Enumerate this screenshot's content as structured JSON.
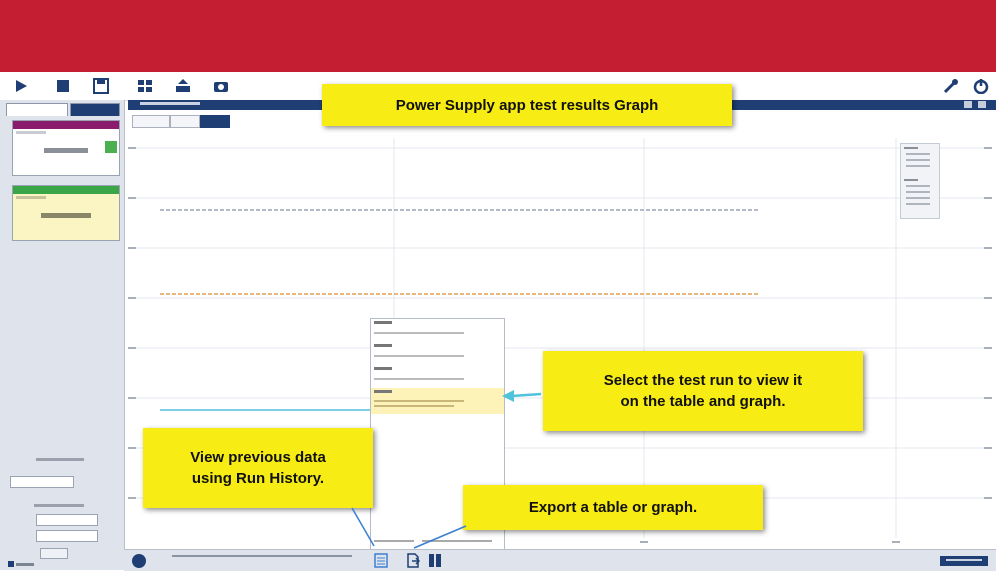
{
  "toolbar": {
    "left_icons": [
      "play-icon",
      "stop-icon",
      "save-icon",
      "layout-icon",
      "export-icon",
      "camera-icon"
    ],
    "right_icons": [
      "wrench-icon",
      "power-icon"
    ]
  },
  "callouts": {
    "title": "Power Supply app test results Graph",
    "select_run": "Select the test run to view it\non the table and graph.",
    "run_history": "View previous data\nusing Run History.",
    "export": "Export a table or graph."
  },
  "colors": {
    "brand_banner": "#c41e33",
    "header_navy": "#1f3e73",
    "callout_yellow": "#f7ec13",
    "arrow_cyan": "#4fc3d9",
    "trace_voltage": "#9aa7b8",
    "trace_current": "#e3a050",
    "trace_selected": "#7fd0e6"
  },
  "chart_data": {
    "type": "line",
    "grid": true,
    "legend_position": "top-right",
    "series": [
      {
        "values": [
          0.82,
          0.82,
          0.82,
          0.82,
          0.82,
          0.82,
          0.82
        ]
      },
      {
        "values": [
          0.61,
          0.61,
          0.61,
          0.61,
          0.61,
          0.61,
          0.61
        ]
      },
      {
        "values": [
          0.32,
          0.32,
          0.32,
          0.32,
          0.32,
          0.32,
          0.32
        ]
      },
      {
        "values": [
          0.1,
          0.1,
          0.1,
          0.1,
          0.1,
          0.1,
          0.1
        ]
      }
    ]
  }
}
